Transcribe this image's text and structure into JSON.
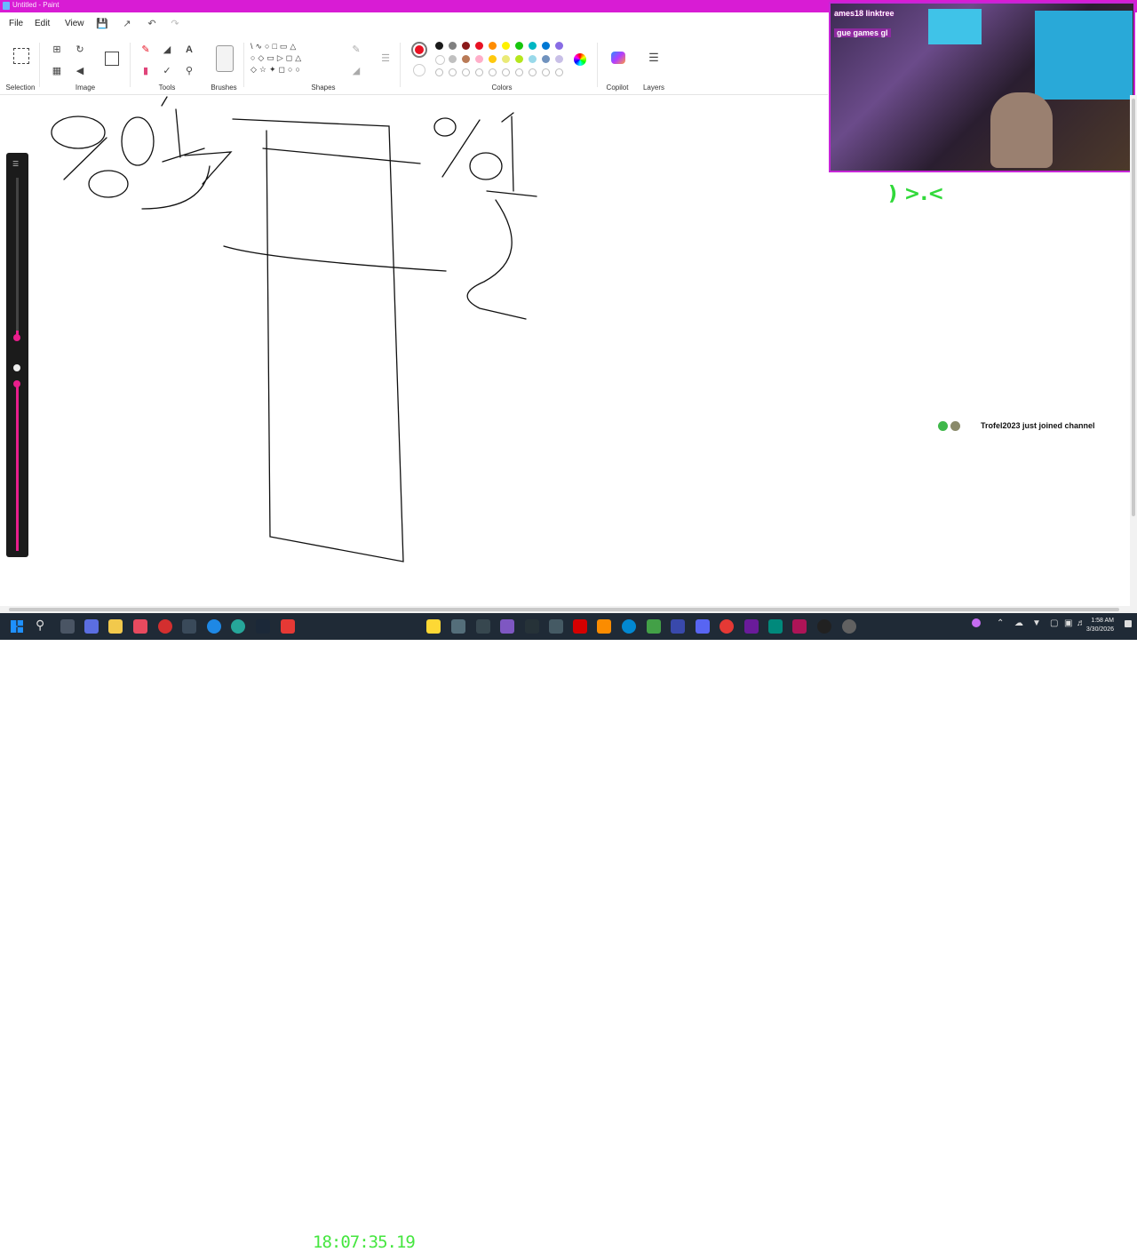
{
  "window": {
    "title": "Untitled - Paint"
  },
  "menu": {
    "file": "File",
    "edit": "Edit",
    "view": "View"
  },
  "ribbon": {
    "groups": {
      "selection": "Selection",
      "image": "Image",
      "tools": "Tools",
      "brushes": "Brushes",
      "shapes": "Shapes",
      "colors": "Colors",
      "copilot": "Copilot",
      "layers": "Layers"
    },
    "palette_row1": [
      "#1a1a1a",
      "#808080",
      "#8b1a1a",
      "#e81123",
      "#ff8c00",
      "#fff100",
      "#16c60c",
      "#00b7c3",
      "#0078d4",
      "#886ce4"
    ],
    "palette_row2": [
      "#ffffff",
      "#c0c0c0",
      "#b97a56",
      "#ffaec9",
      "#ffc90e",
      "#eaea76",
      "#b5e61d",
      "#99d9ea",
      "#7092be",
      "#c8bfe7"
    ],
    "active_color": "#e81123",
    "secondary_color": "#ffffff"
  },
  "stream_overlay": {
    "emote": ") >.<",
    "chat_notice": "Trofel2023 just joined channel",
    "clock": "18:07:35.19",
    "webcam_banner_top": "ames18 linktree",
    "webcam_banner_bottom": "gue games gl"
  },
  "taskbar": {
    "time": "1:58 AM",
    "date": "3/30/2026"
  },
  "colors": {
    "titlebar": "#d81cd4",
    "accent": "#d81cd4",
    "taskbar": "#1f2a36"
  }
}
